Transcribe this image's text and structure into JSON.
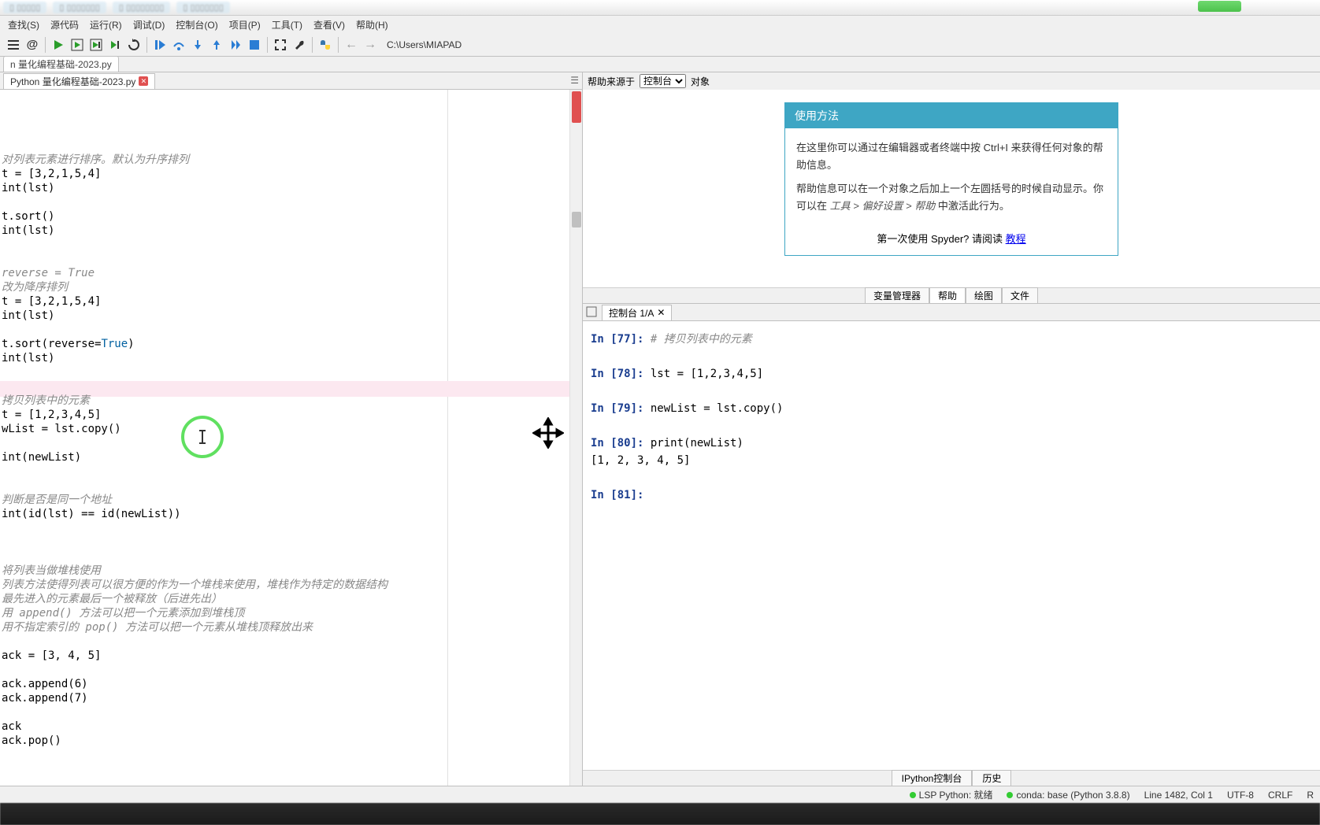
{
  "menubar": {
    "items": [
      "查找(S)",
      "源代码",
      "运行(R)",
      "调试(D)",
      "控制台(O)",
      "项目(P)",
      "工具(T)",
      "查看(V)",
      "帮助(H)"
    ]
  },
  "toolbar": {
    "path": "C:\\Users\\MIAPAD"
  },
  "main_tab": "n 量化编程基础-2023.py",
  "editor_tab": "Python 量化编程基础-2023.py",
  "help": {
    "source_label": "帮助来源于",
    "source_value": "控制台",
    "object_label": "对象",
    "title": "使用方法",
    "body1": "在这里你可以通过在编辑器或者终端中按 Ctrl+I 来获得任何对象的帮助信息。",
    "body2_a": "帮助信息可以在一个对象之后加上一个左圆括号的时候自动显示。你可以在 ",
    "body2_b": "工具 > 偏好设置 > 帮助",
    "body2_c": " 中激活此行为。",
    "footer_text": "第一次使用 Spyder? 请阅读 ",
    "footer_link": "教程",
    "tabs": [
      "变量管理器",
      "帮助",
      "绘图",
      "文件"
    ]
  },
  "console": {
    "tab": "控制台 1/A",
    "lines": [
      {
        "prompt": "In [77]:",
        "text": " # 拷贝列表中的元素",
        "comment": true
      },
      {
        "blank": true
      },
      {
        "prompt": "In [78]:",
        "text": " lst = [1,2,3,4,5]"
      },
      {
        "blank": true
      },
      {
        "prompt": "In [79]:",
        "text": " newList = lst.copy()"
      },
      {
        "blank": true
      },
      {
        "prompt": "In [80]:",
        "text": " print(newList)"
      },
      {
        "out": "[1, 2, 3, 4, 5]"
      },
      {
        "blank": true
      },
      {
        "prompt": "In [81]:",
        "text": ""
      }
    ],
    "bottom_tabs": [
      "IPython控制台",
      "历史"
    ]
  },
  "status": {
    "lsp": "LSP Python: 就绪",
    "conda": "conda: base (Python 3.8.8)",
    "pos": "Line 1482, Col 1",
    "enc": "UTF-8",
    "eol": "CRLF",
    "rw": "R"
  },
  "editor_code": [
    {
      "t": "对列表元素进行排序。默认为升序排列",
      "c": "comment"
    },
    {
      "t": "t = [3,2,1,5,4]"
    },
    {
      "t": "int(lst)"
    },
    {
      "t": ""
    },
    {
      "t": "t.sort()"
    },
    {
      "t": "int(lst)"
    },
    {
      "t": ""
    },
    {
      "t": ""
    },
    {
      "t": "reverse = True",
      "c": "comment"
    },
    {
      "t": "改为降序排列",
      "c": "comment"
    },
    {
      "t": "t = [3,2,1,5,4]"
    },
    {
      "t": "int(lst)"
    },
    {
      "t": ""
    },
    {
      "t": "t.sort(reverse=True)",
      "true": true
    },
    {
      "t": "int(lst)"
    },
    {
      "t": ""
    },
    {
      "t": ""
    },
    {
      "t": "拷贝列表中的元素",
      "c": "comment"
    },
    {
      "t": "t = [1,2,3,4,5]"
    },
    {
      "t": "wList = lst.copy()"
    },
    {
      "t": ""
    },
    {
      "t": "int(newList)"
    },
    {
      "t": ""
    },
    {
      "t": ""
    },
    {
      "t": "判断是否是同一个地址",
      "c": "comment"
    },
    {
      "t": "int(id(lst) == id(newList))"
    },
    {
      "t": ""
    },
    {
      "t": ""
    },
    {
      "t": ""
    },
    {
      "t": "将列表当做堆栈使用",
      "c": "comment"
    },
    {
      "t": "列表方法使得列表可以很方便的作为一个堆栈来使用，堆栈作为特定的数据结构",
      "c": "comment"
    },
    {
      "t": "最先进入的元素最后一个被释放（后进先出）",
      "c": "comment"
    },
    {
      "t": "用 append() 方法可以把一个元素添加到堆栈顶",
      "c": "comment"
    },
    {
      "t": "用不指定索引的 pop() 方法可以把一个元素从堆栈顶释放出来",
      "c": "comment"
    },
    {
      "t": ""
    },
    {
      "t": "ack = [3, 4, 5]"
    },
    {
      "t": ""
    },
    {
      "t": "ack.append(6)"
    },
    {
      "t": "ack.append(7)"
    },
    {
      "t": ""
    },
    {
      "t": "ack"
    },
    {
      "t": "ack.pop()"
    }
  ]
}
